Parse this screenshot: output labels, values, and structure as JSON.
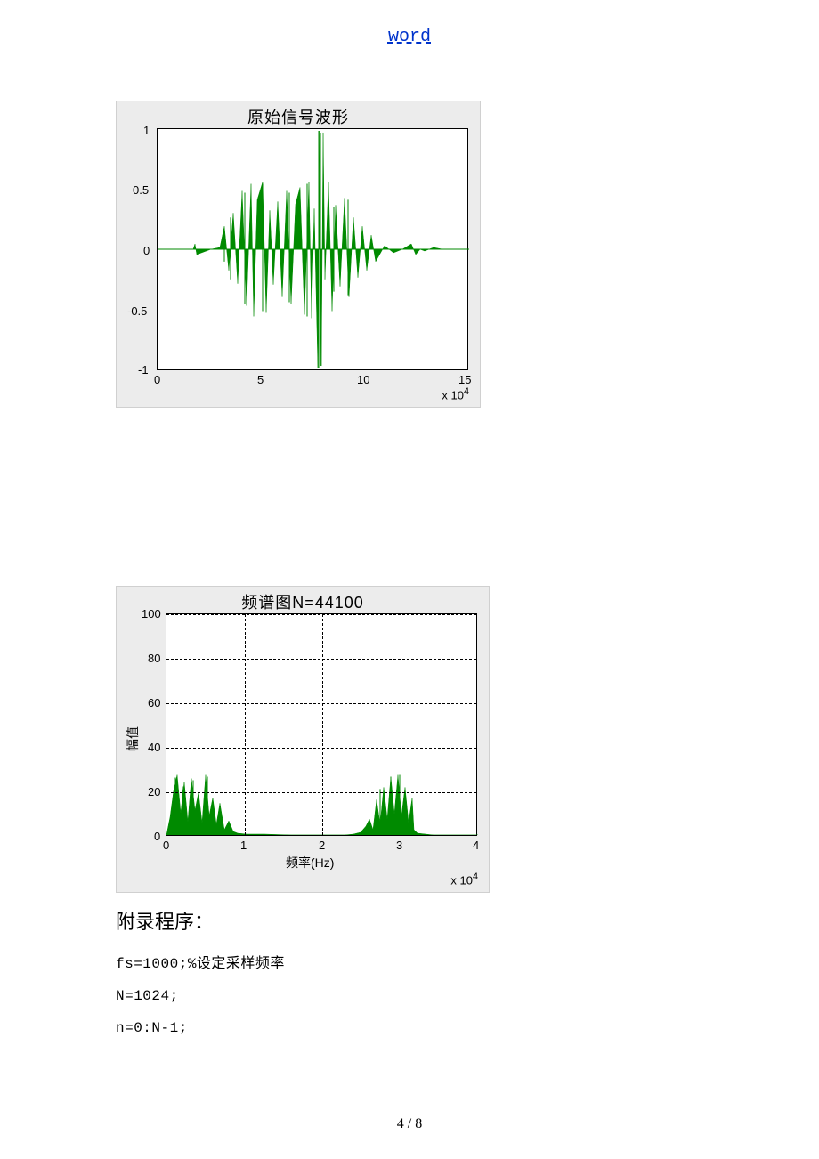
{
  "header_link": "word",
  "figure1": {
    "title": "原始信号波形",
    "y_ticks": [
      "1",
      "0.5",
      "0",
      "-0.5",
      "-1"
    ],
    "x_ticks": [
      "0",
      "5",
      "10",
      "15"
    ],
    "x_exp": "x 10",
    "x_exp_sup": "4"
  },
  "figure2": {
    "title": "频谱图N=44100",
    "y_ticks": [
      "100",
      "80",
      "60",
      "40",
      "20",
      "0"
    ],
    "x_ticks": [
      "0",
      "1",
      "2",
      "3",
      "4"
    ],
    "ylabel": "幅值",
    "xlabel": "频率(Hz)",
    "x_exp": "x 10",
    "x_exp_sup": "4"
  },
  "section_title": "附录程序：",
  "code": {
    "line1": "fs=1000;%设定采样频率",
    "line2": "N=1024;",
    "line3": "n=0:N-1;"
  },
  "page_num": "4 / 8",
  "chart_data": [
    {
      "type": "line",
      "title": "原始信号波形",
      "xlim": [
        0,
        150000
      ],
      "ylim": [
        -1,
        1
      ],
      "x_ticks": [
        0,
        50000,
        100000,
        150000
      ],
      "y_ticks": [
        -1,
        -0.5,
        0,
        0.5,
        1
      ],
      "note": "Audio waveform; dense oscillatory signal roughly between x≈30000 and x≈120000, peak amplitude ≈ ±1 near x≈78000, near-zero outside that range."
    },
    {
      "type": "line",
      "title": "频谱图N=44100",
      "xlabel": "频率(Hz)",
      "ylabel": "幅值",
      "xlim": [
        0,
        40000
      ],
      "ylim": [
        0,
        100
      ],
      "x_ticks": [
        0,
        10000,
        20000,
        30000,
        40000
      ],
      "y_ticks": [
        0,
        20,
        40,
        60,
        80,
        100
      ],
      "grid": true,
      "note": "Spectrum magnitude; energy clustered roughly 0–8000 Hz (peaks up to ≈28) and mirrored cluster ≈25000–32000 Hz (peaks up to ≈28), near-zero in between."
    }
  ]
}
